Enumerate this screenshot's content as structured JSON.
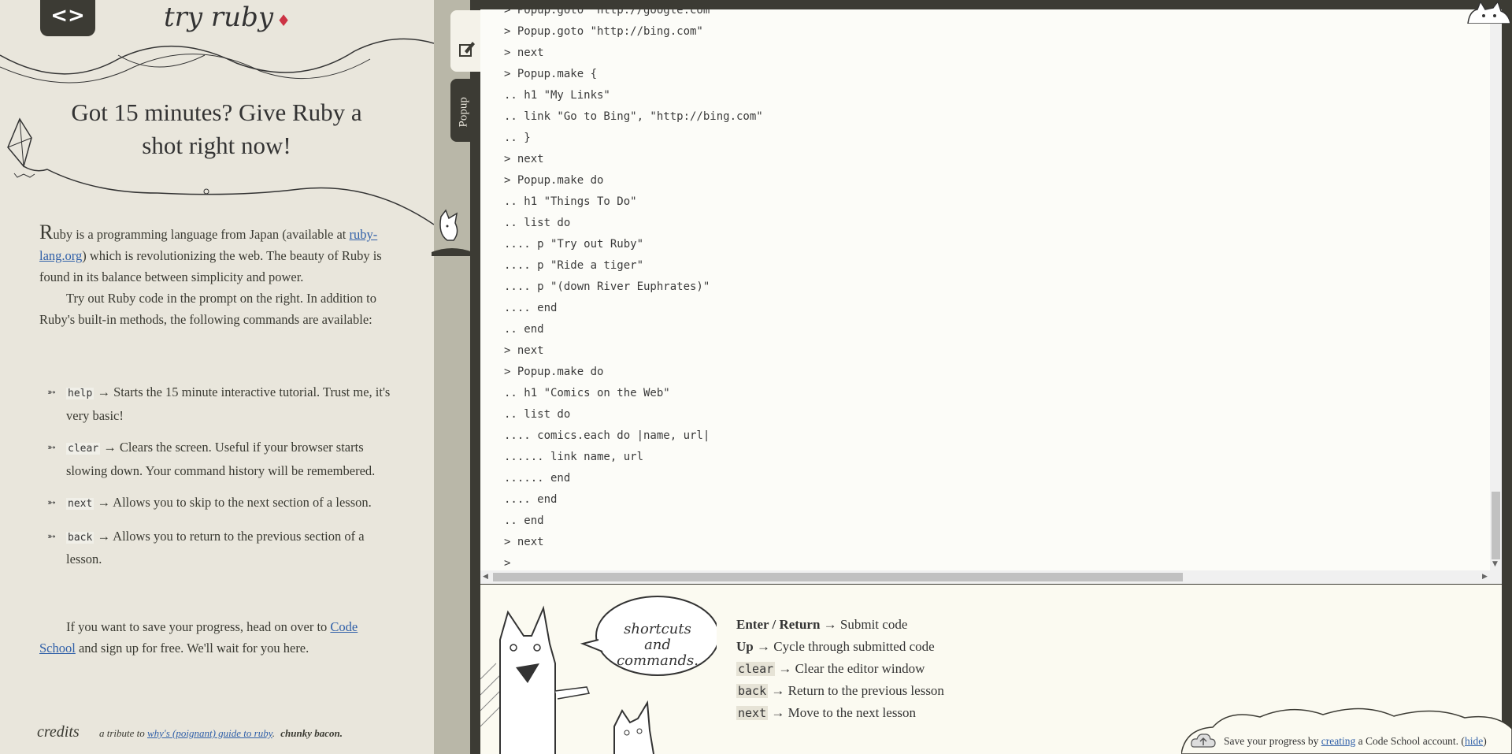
{
  "header": {
    "logo_symbol": "<>",
    "brand": "try ruby",
    "brand_gem": "♦"
  },
  "intro": {
    "headline": "Got 15 minutes? Give Ruby a shot right now!",
    "para1_initial": "R",
    "para1_a": "uby is a programming language from Japan (available at ",
    "para1_link": "ruby-lang.org",
    "para1_b": ") which is revolutionizing the web. The beauty of Ruby is found in its balance between simplicity and power.",
    "para2": "Try out Ruby code in the prompt on the right. In addition to Ruby's built-in methods, the following commands are available:"
  },
  "commands": [
    {
      "cmd": "help",
      "desc": "→ Starts the 15 minute interactive tutorial. Trust me, it's very basic!"
    },
    {
      "cmd": "clear",
      "desc": "→ Clears the screen. Useful if your browser starts slowing down. Your command history will be remembered."
    },
    {
      "cmd": "next",
      "desc": "→ Allows you to skip to the next section of a lesson."
    },
    {
      "cmd": "back",
      "desc": "→ Allows you to return to the previous section of a lesson."
    }
  ],
  "save_note": {
    "text_a": "If you want to save your progress, head on over to ",
    "link": "Code School",
    "text_b": " and sign up for free. We'll wait for you here."
  },
  "footer": {
    "credits": "credits",
    "tribute_a": "a tribute to ",
    "tribute_link": "why's (poignant) guide to ruby",
    "tribute_b": ".",
    "bacon": "chunky bacon."
  },
  "side_tabs": {
    "popup_label": "Popup"
  },
  "console": {
    "lines": [
      "> Popup.goto \"http://google.com\"",
      "> Popup.goto \"http://bing.com\"",
      "> next",
      "> Popup.make {",
      ".. h1 \"My Links\"",
      ".. link \"Go to Bing\", \"http://bing.com\"",
      ".. }",
      "> next",
      "> Popup.make do",
      ".. h1 \"Things To Do\"",
      ".. list do",
      ".... p \"Try out Ruby\"",
      ".... p \"Ride a tiger\"",
      ".... p \"(down River Euphrates)\"",
      ".... end",
      ".. end",
      "> next",
      "> Popup.make do",
      ".. h1 \"Comics on the Web\"",
      ".. list do",
      ".... comics.each do |name, url|",
      "...... link name, url",
      "...... end",
      ".... end",
      ".. end",
      "> next",
      ">"
    ]
  },
  "shortcuts": {
    "bubble": "shortcuts and commands.",
    "items": [
      {
        "key": "Enter / Return",
        "is_code": false,
        "desc": "→ Submit code"
      },
      {
        "key": "Up",
        "is_code": false,
        "desc": "→ Cycle through submitted code"
      },
      {
        "key": "clear",
        "is_code": true,
        "desc": "→ Clear the editor window"
      },
      {
        "key": "back",
        "is_code": true,
        "desc": "→ Return to the previous lesson"
      },
      {
        "key": "next",
        "is_code": true,
        "desc": "→ Move to the next lesson"
      }
    ]
  },
  "save_prompt": {
    "text_a": "Save your progress by ",
    "link": "creating",
    "text_b": " a Code School account. (",
    "hide": "hide",
    "text_c": ")"
  },
  "colors": {
    "frame": "#3c3b34",
    "paper": "#e9e6dc",
    "link": "#2f5fa8",
    "gem": "#cc3344"
  }
}
